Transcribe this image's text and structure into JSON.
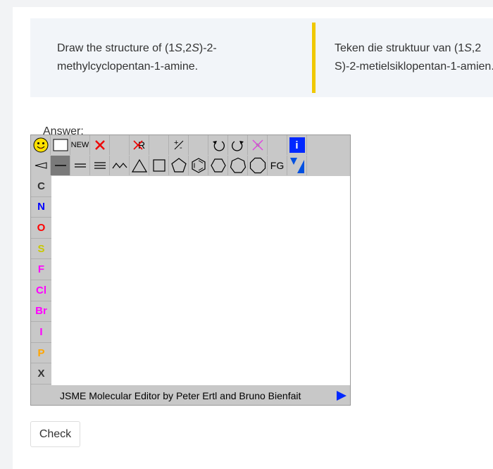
{
  "question": {
    "english_prefix": "Draw the structure of (1",
    "english_s1": "S",
    "english_mid": ",2",
    "english_s2": "S",
    "english_suffix": ")-2-methylcyclopentan-1-amine.",
    "afrikaans_prefix": "Teken die struktuur van (1",
    "afrikaans_s1": "S",
    "afrikaans_mid": ",2",
    "afrikaans_suffix": "S)-2-metielsiklopentan-1-amien."
  },
  "answer_label": "Answer:",
  "jsme": {
    "toolbar1": {
      "new_label": "NEW",
      "charge_label": "+/-",
      "info_label": "i"
    },
    "toolbar2": {
      "fg_label": "FG"
    },
    "atoms": [
      "C",
      "N",
      "O",
      "S",
      "F",
      "Cl",
      "Br",
      "I",
      "P",
      "X"
    ],
    "atom_colors": [
      "#333333",
      "#0000ff",
      "#ff0000",
      "#c8c800",
      "#ff00ff",
      "#ff00ff",
      "#ff00ff",
      "#ff00ff",
      "#ffa500",
      "#333333"
    ],
    "status_text": "JSME Molecular Editor by Peter Ertl and Bruno Bienfait"
  },
  "check_label": "Check"
}
